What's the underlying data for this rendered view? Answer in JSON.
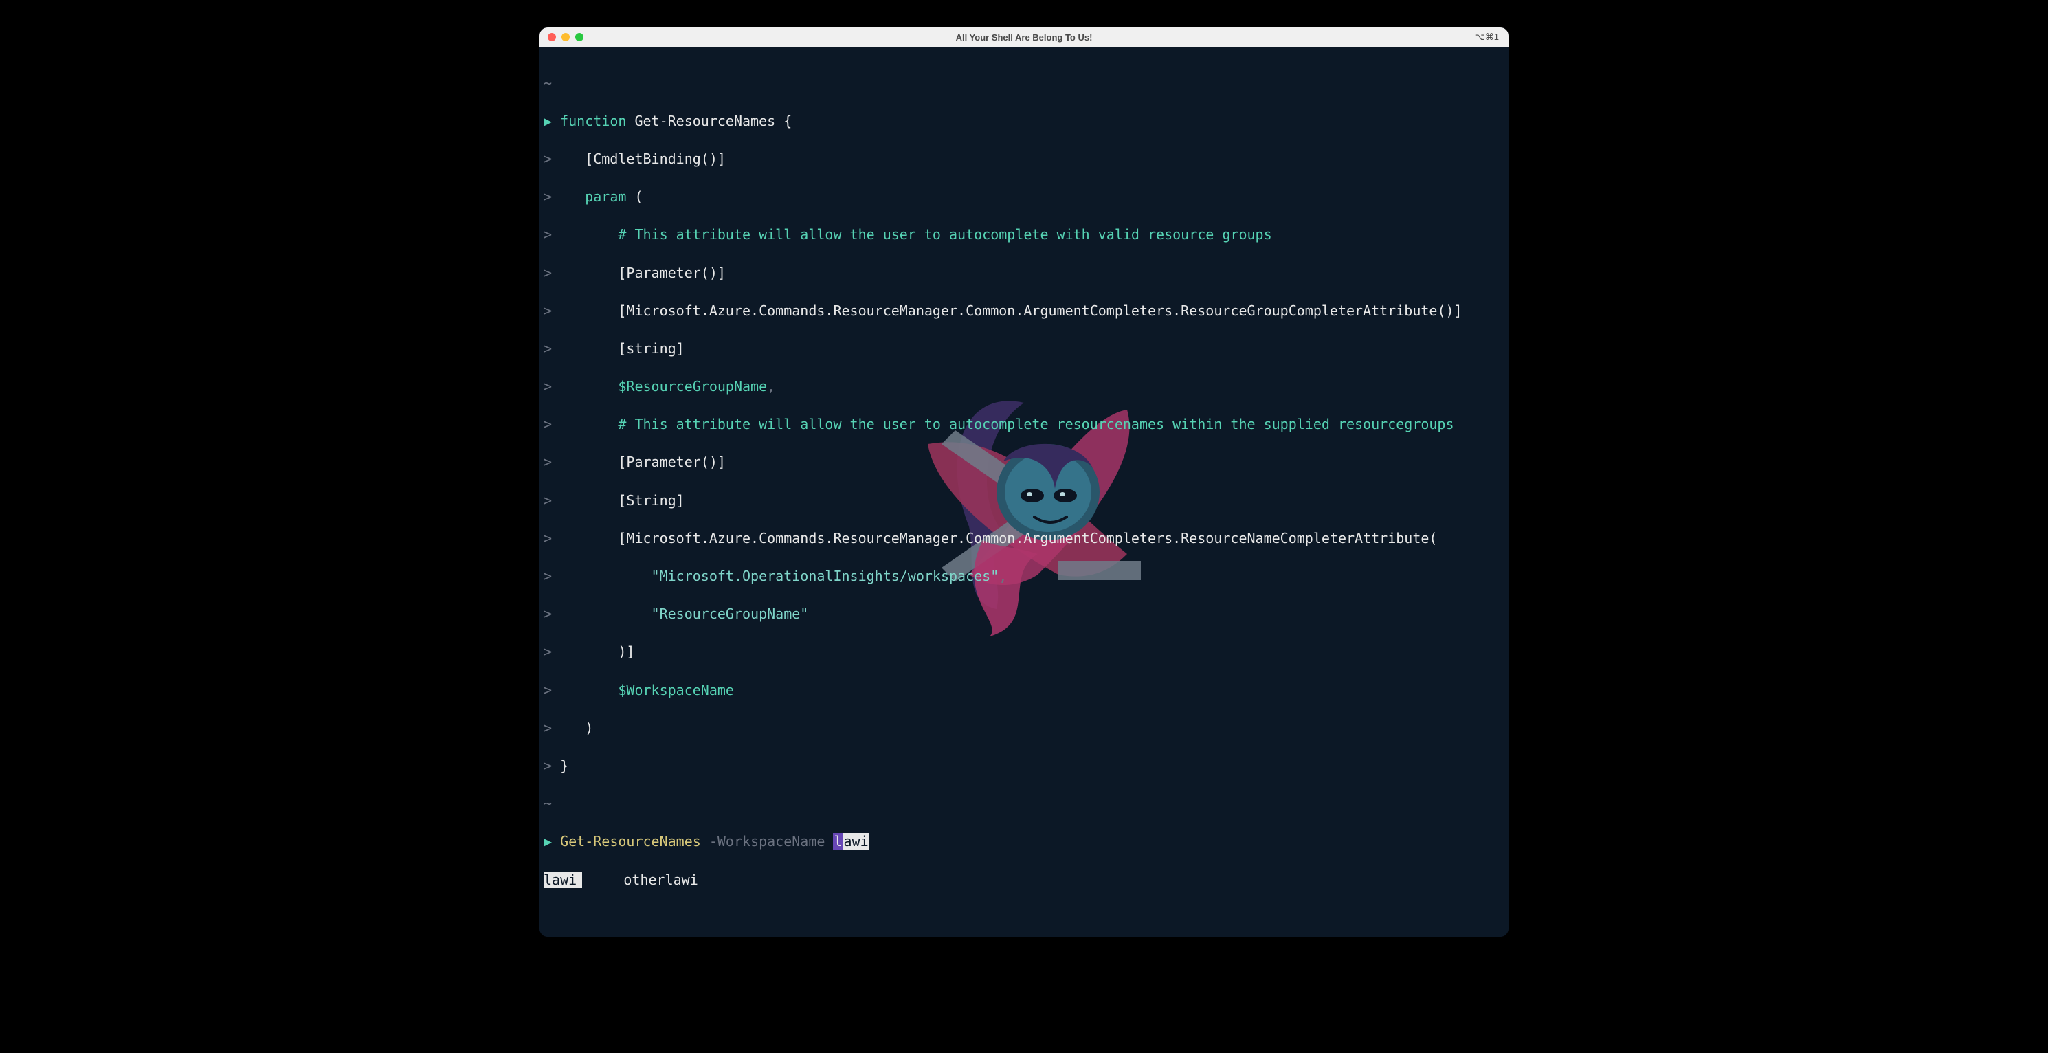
{
  "titlebar": {
    "title": "All Your Shell Are Belong To Us!",
    "shortcut": "⌥⌘1"
  },
  "lines": {
    "tilde": "~",
    "l1_prompt": "▶",
    "l1_kw": "function",
    "l1_name": " Get-ResourceNames ",
    "l1_brace": "{",
    "l2_g": ">",
    "l2_t": "    [CmdletBinding()]",
    "l3_g": ">",
    "l3_kw": "param",
    "l3_t": " (",
    "l4_g": ">",
    "l4_c": "        # This attribute will allow the user to autocomplete with valid resource groups",
    "l5_g": ">",
    "l5_t": "        [Parameter()]",
    "l6_g": ">",
    "l6_t": "        [Microsoft.Azure.Commands.ResourceManager.Common.ArgumentCompleters.ResourceGroupCompleterAttribute()]",
    "l7_g": ">",
    "l7_t": "        [string]",
    "l8_g": ">",
    "l8_v": "        $ResourceGroupName",
    "l8_p": ",",
    "l9_g": ">",
    "l9_c": "        # This attribute will allow the user to autocomplete resourcenames within the supplied resourcegroups",
    "l10_g": ">",
    "l10_t": "        [Parameter()]",
    "l11_g": ">",
    "l11_t": "        [String]",
    "l12_g": ">",
    "l12_t": "        [Microsoft.Azure.Commands.ResourceManager.Common.ArgumentCompleters.ResourceNameCompleterAttribute(",
    "l13_g": ">",
    "l13_s": "            \"Microsoft.OperationalInsights/workspaces\"",
    "l13_p": ",",
    "l14_g": ">",
    "l14_s": "            \"ResourceGroupName\"",
    "l15_g": ">",
    "l15_t": "        )]",
    "l16_g": ">",
    "l16_v": "        $WorkspaceName",
    "l17_g": ">",
    "l17_t": "    )",
    "l18_g": ">",
    "l18_t": " }",
    "cmd_prompt": "▶",
    "cmd_name": " Get-ResourceNames",
    "cmd_param": " -WorkspaceName ",
    "cmd_inp_pre": "l",
    "cmd_inp": "awi",
    "comp1": "lawi",
    "comp_sep": "     ",
    "comp2": "otherlawi"
  }
}
